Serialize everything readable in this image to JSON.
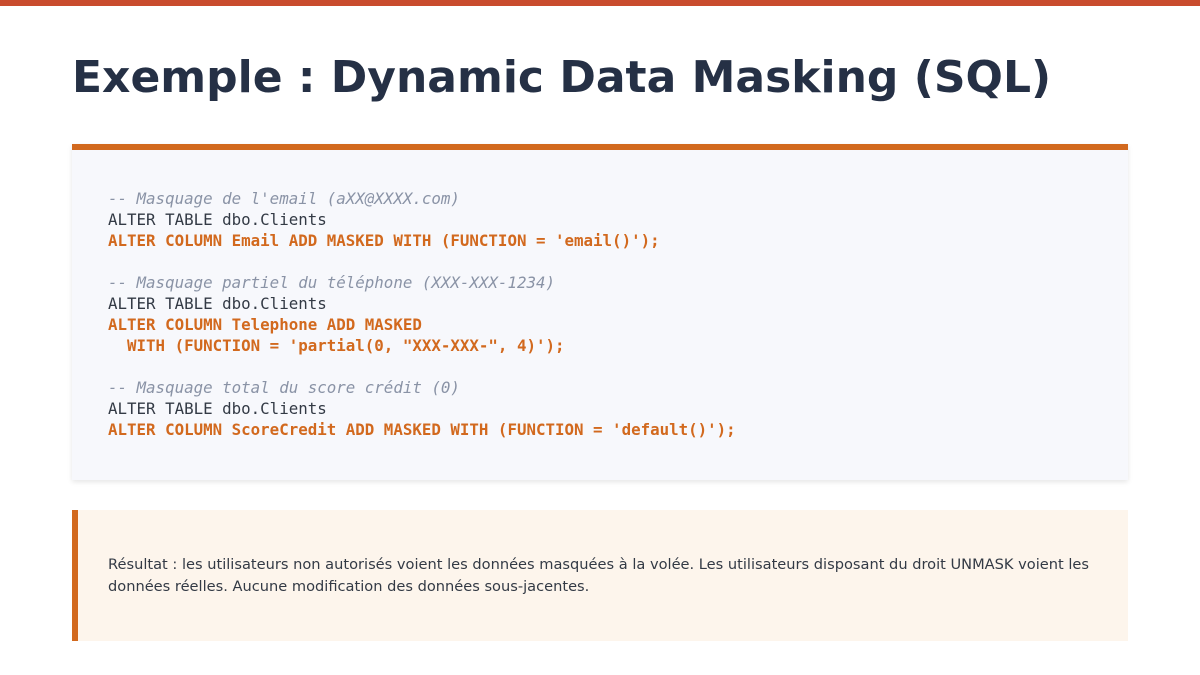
{
  "colors": {
    "top_bar": "#c94c2e",
    "accent": "#d2691e",
    "title": "#253045"
  },
  "slide": {
    "title": "Exemple : Dynamic Data Masking (SQL)"
  },
  "code": {
    "lines": [
      {
        "type": "comment",
        "text": "-- Masquage de l'email (aXX@XXXX.com)"
      },
      {
        "type": "plain",
        "text": "ALTER TABLE dbo.Clients"
      },
      {
        "type": "keyword",
        "text": "ALTER COLUMN Email ADD MASKED WITH (FUNCTION = 'email()');"
      },
      {
        "type": "blank",
        "text": ""
      },
      {
        "type": "comment",
        "text": "-- Masquage partiel du téléphone (XXX-XXX-1234)"
      },
      {
        "type": "plain",
        "text": "ALTER TABLE dbo.Clients"
      },
      {
        "type": "keyword",
        "text": "ALTER COLUMN Telephone ADD MASKED"
      },
      {
        "type": "keyword",
        "text": "  WITH (FUNCTION = 'partial(0, \"XXX-XXX-\", 4)');"
      },
      {
        "type": "blank",
        "text": ""
      },
      {
        "type": "comment",
        "text": "-- Masquage total du score crédit (0)"
      },
      {
        "type": "plain",
        "text": "ALTER TABLE dbo.Clients"
      },
      {
        "type": "keyword",
        "text": "ALTER COLUMN ScoreCredit ADD MASKED WITH (FUNCTION = 'default()');"
      }
    ]
  },
  "result": {
    "text": "Résultat : les utilisateurs non autorisés voient les données masquées à la volée. Les utilisateurs disposant du droit UNMASK voient les données réelles. Aucune modification des données sous-jacentes."
  }
}
